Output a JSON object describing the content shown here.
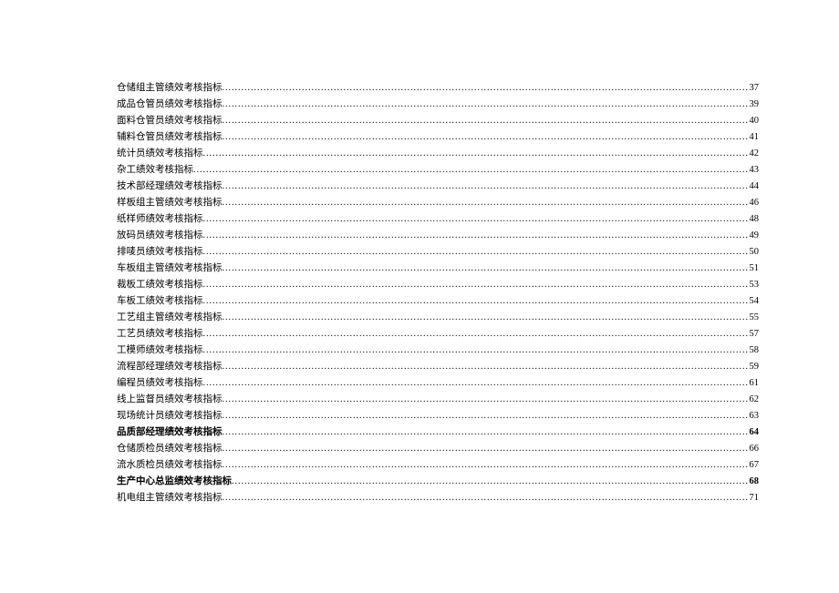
{
  "toc": {
    "entries": [
      {
        "title": "仓储组主管绩效考核指标",
        "page": "37",
        "bold": false
      },
      {
        "title": "成品仓管员绩效考核指标",
        "page": "39",
        "bold": false
      },
      {
        "title": "面料仓管员绩效考核指标",
        "page": "40",
        "bold": false
      },
      {
        "title": "辅料仓管员绩效考核指标",
        "page": "41",
        "bold": false
      },
      {
        "title": "统计员绩效考核指标",
        "page": "42",
        "bold": false
      },
      {
        "title": "杂工绩效考核指标",
        "page": "43",
        "bold": false
      },
      {
        "title": "技术部经理绩效考核指标",
        "page": "44",
        "bold": false
      },
      {
        "title": "样板组主管绩效考核指标",
        "page": "46",
        "bold": false
      },
      {
        "title": "纸样师绩效考核指标",
        "page": "48",
        "bold": false
      },
      {
        "title": "放码员绩效考核指标",
        "page": "49",
        "bold": false
      },
      {
        "title": "排唛员绩效考核指标",
        "page": "50",
        "bold": false
      },
      {
        "title": "车板组主管绩效考核指标",
        "page": "51",
        "bold": false
      },
      {
        "title": "裁板工绩效考核指标",
        "page": "53",
        "bold": false
      },
      {
        "title": "车板工绩效考核指标",
        "page": "54",
        "bold": false
      },
      {
        "title": "工艺组主管绩效考核指标",
        "page": "55",
        "bold": false
      },
      {
        "title": "工艺员绩效考核指标",
        "page": "57",
        "bold": false
      },
      {
        "title": "工模师绩效考核指标",
        "page": "58",
        "bold": false
      },
      {
        "title": "流程部经理绩效考核指标",
        "page": "59",
        "bold": false
      },
      {
        "title": "编程员绩效考核指标",
        "page": "61",
        "bold": false
      },
      {
        "title": "线上监督员绩效考核指标",
        "page": "62",
        "bold": false
      },
      {
        "title": "现场统计员绩效考核指标",
        "page": "63",
        "bold": false
      },
      {
        "title": "品质部经理绩效考核指标",
        "page": "64",
        "bold": true
      },
      {
        "title": "仓储质检员绩效考核指标",
        "page": "66",
        "bold": false
      },
      {
        "title": "流水质检员绩效考核指标",
        "page": "67",
        "bold": false
      },
      {
        "title": "生产中心总监绩效考核指标",
        "page": "68",
        "bold": true
      },
      {
        "title": "机电组主管绩效考核指标",
        "page": "71",
        "bold": false
      }
    ]
  }
}
